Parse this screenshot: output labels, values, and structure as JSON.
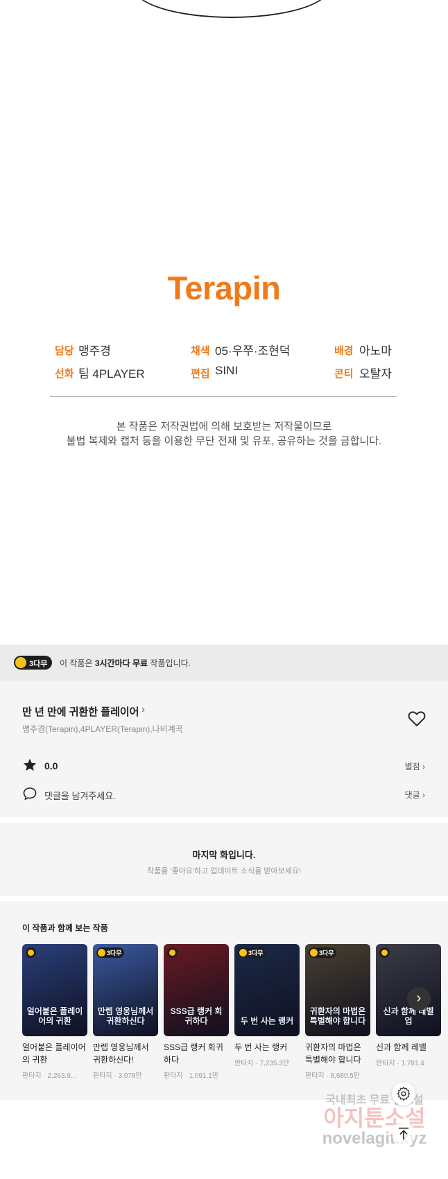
{
  "brand": {
    "logo_text": "Terapin",
    "accent": "#f07a1a"
  },
  "credits": [
    {
      "key": "담당",
      "value": "맹주경"
    },
    {
      "key": "채색",
      "value": "05·우쭈·조현덕"
    },
    {
      "key": "배경",
      "value": "아노마"
    },
    {
      "key": "선화",
      "value": "팀 4PLAYER"
    },
    {
      "key": "편집",
      "value": "SINI"
    },
    {
      "key": "콘티",
      "value": "오탈자"
    }
  ],
  "copyright": {
    "line1": "본 작품은 저작권법에 의해 보호받는 저작물이므로",
    "line2": "불법 복제와 캡처 등을 이용한 무단 전재 및 유포, 공유하는 것을 금합니다."
  },
  "free_banner": {
    "badge": "3다무",
    "text_pre": "이 작품은 ",
    "text_bold": "3시간마다 무료",
    "text_post": " 작품입니다."
  },
  "series": {
    "title": "만 년 만에 귀환한 플레이어",
    "authors": "맹주경(Terapin),4PLAYER(Terapin),나비계곡",
    "rating": "0.0",
    "rate_label": "별점 ›",
    "comment_prompt": "댓글을 남겨주세요.",
    "comments_label": "댓글 ›"
  },
  "last_episode": {
    "title": "마지막 화입니다.",
    "subtitle": "작품을 '좋아요'하고 업데이트 소식을 받아보세요!"
  },
  "recommendations": {
    "heading": "이 작품과 함께 보는 작품",
    "items": [
      {
        "title": "얼어붙은 플레이어의 귀환",
        "meta": "판타지 · 2,263.9...",
        "cover_text": "얼어붙은 플레이어의 귀환",
        "badge": "",
        "cover_color": "#2a3f7a"
      },
      {
        "title": "만렙 영웅님께서 귀환하신다!",
        "meta": "판타지 · 3,078만",
        "cover_text": "만렙 영웅님께서 귀환하신다",
        "badge": "3다무",
        "cover_color": "#3a5aa0"
      },
      {
        "title": "SSS급 랭커 회귀하다",
        "meta": "판타지 · 1,091.1만",
        "cover_text": "SSS급 랭커 회귀하다",
        "badge": "",
        "cover_color": "#6a1a22"
      },
      {
        "title": "두 번 사는 랭커",
        "meta": "판타지 · 7,235.3만",
        "cover_text": "두 번 사는 랭커",
        "badge": "3다무",
        "cover_color": "#1c2a48"
      },
      {
        "title": "귀환자의 마법은 특별해야 합니다",
        "meta": "판타지 · 8,680.5만",
        "cover_text": "귀환자의 마법은 특별해야 합니다",
        "badge": "3다무",
        "cover_color": "#4a4030"
      },
      {
        "title": "신과 함께 레벨",
        "meta": "판타지 · 1,781.4",
        "cover_text": "신과 함께 레벨업",
        "badge": "",
        "cover_color": "#3c3c46"
      }
    ]
  },
  "watermark": {
    "line1": "국내최초 무료 웹소설",
    "line2": "아지툰소설",
    "line3": "novelagit.xyz"
  }
}
